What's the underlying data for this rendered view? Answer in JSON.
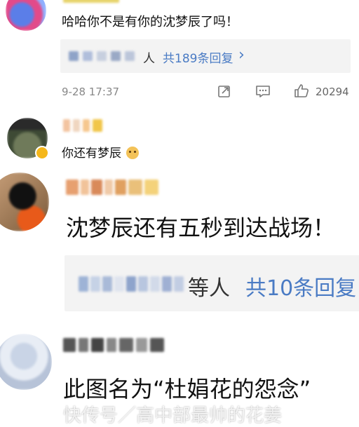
{
  "comments": [
    {
      "text": "哈哈你不是有你的沈梦辰了吗！",
      "reply_summary": {
        "name_suffix": "人",
        "count_label": "共189条回复",
        "arrow": "›"
      },
      "date": "9-28 17:37",
      "like_count": "20294"
    },
    {
      "text": "你还有梦辰",
      "emoji": "doge-emoji"
    },
    {
      "text": "沈梦辰还有五秒到达战场！",
      "reply_summary": {
        "name_suffix": "等人",
        "count_label": "共10条回复"
      }
    },
    {
      "text": "此图名为“杜娟花的怨念”"
    }
  ],
  "watermark": "快传号／高中部最帅的花姜",
  "colors": {
    "link": "#4a7bc4",
    "muted": "#888888",
    "reply_bg": "#f3f3f3",
    "watermark": "#ffffff"
  },
  "icons": [
    "share-icon",
    "comment-icon",
    "like-icon",
    "chevron-right-icon"
  ]
}
